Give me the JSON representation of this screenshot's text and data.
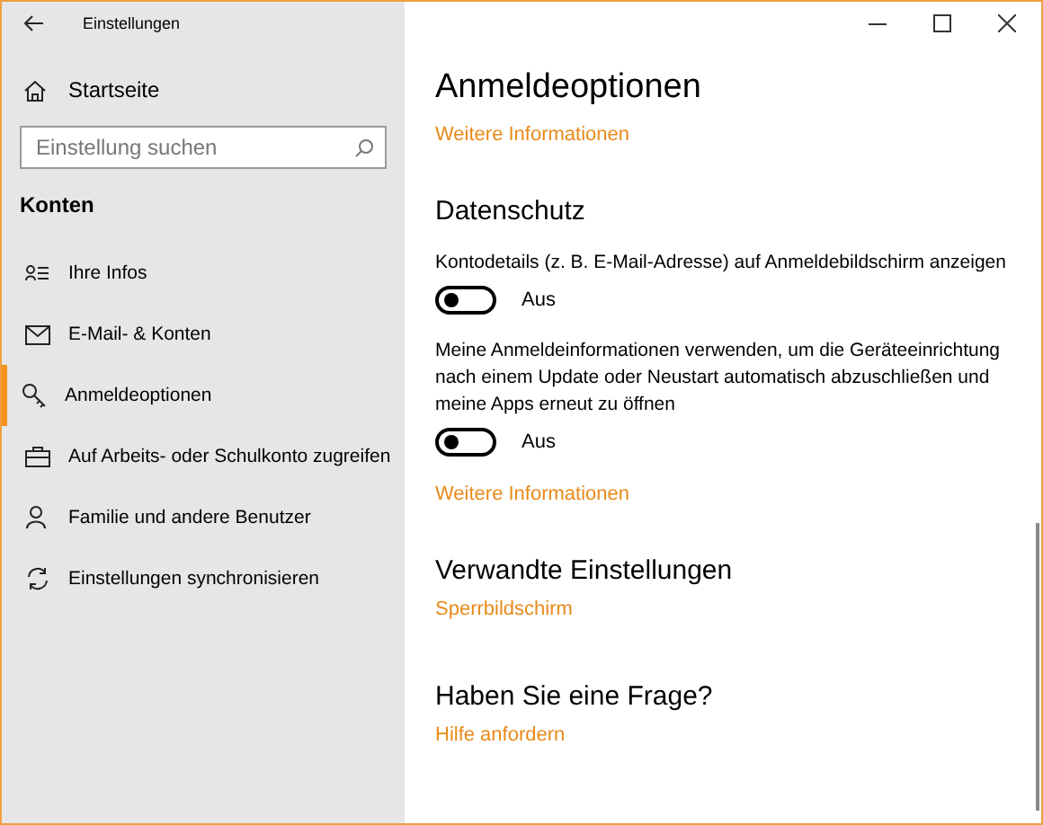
{
  "window": {
    "title": "Einstellungen"
  },
  "sidebar": {
    "home": "Startseite",
    "search": {
      "placeholder": "Einstellung suchen"
    },
    "section": "Konten",
    "items": [
      {
        "kind": "info",
        "label": "Ihre Infos",
        "selected": false
      },
      {
        "kind": "mail",
        "label": "E-Mail- & Konten",
        "selected": false
      },
      {
        "kind": "key",
        "label": "Anmeldeoptionen",
        "selected": true
      },
      {
        "kind": "briefcase",
        "label": "Auf Arbeits- oder Schulkonto zugreifen",
        "selected": false
      },
      {
        "kind": "person",
        "label": "Familie und andere Benutzer",
        "selected": false
      },
      {
        "kind": "sync",
        "label": "Einstellungen synchronisieren",
        "selected": false
      }
    ]
  },
  "main": {
    "title": "Anmeldeoptionen",
    "link": "Weitere Informationen",
    "privacy": {
      "heading": "Datenschutz",
      "settings": [
        {
          "text": "Kontodetails (z. B. E-Mail-Adresse) auf Anmeldebildschirm anzeigen",
          "on": false,
          "state": "Aus"
        },
        {
          "text": "Meine Anmeldeinformationen verwenden, um die Geräteeinrichtung nach einem Update oder Neustart automatisch abzuschließen und meine Apps erneut zu öffnen",
          "on": false,
          "state": "Aus"
        }
      ],
      "link": "Weitere Informationen"
    },
    "related": {
      "heading": "Verwandte Einstellungen",
      "link": "Sperrbildschirm"
    },
    "question": {
      "heading": "Haben Sie eine Frage?",
      "link": "Hilfe anfordern"
    }
  }
}
